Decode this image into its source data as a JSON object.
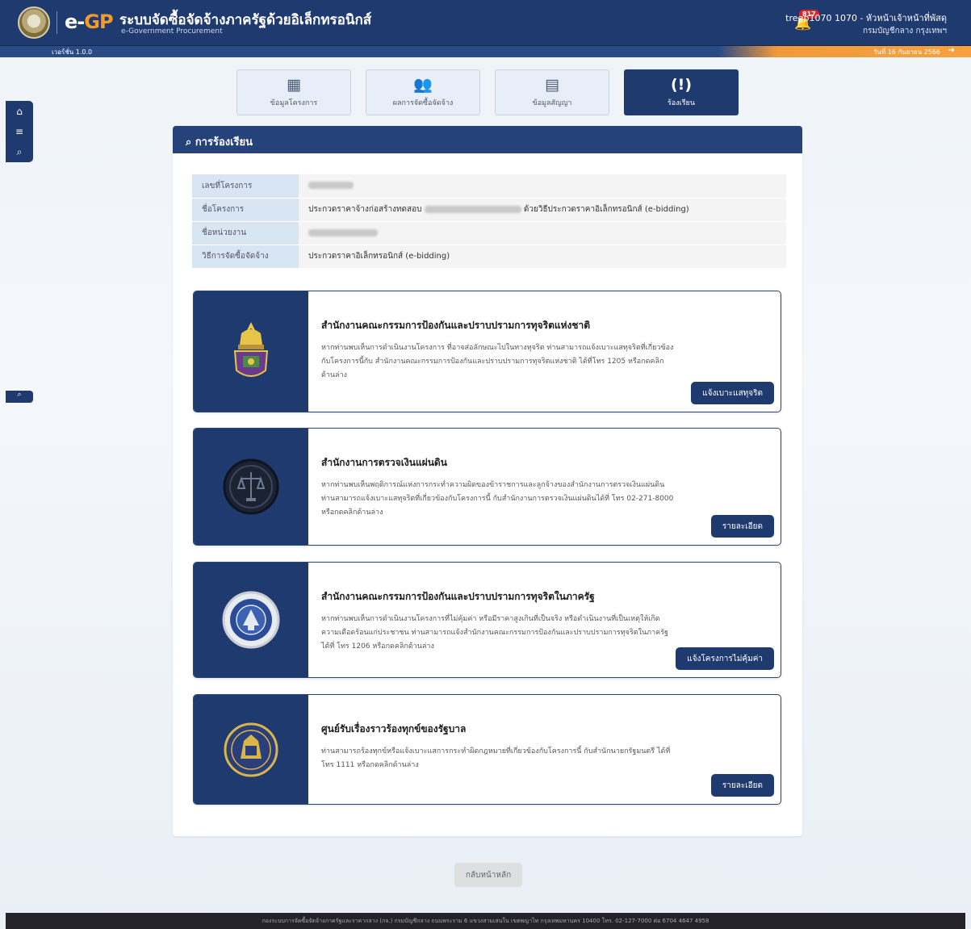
{
  "header": {
    "logo_main": "e-",
    "logo_accent": "GP",
    "app_title": "ระบบจัดซื้อจัดจ้างภาครัฐด้วยอิเล็กทรอนิกส์",
    "app_subtitle": "e-Government Procurement",
    "notification_count": "817",
    "user_name": "tregp1070 1070 - หัวหน้าเจ้าหน้าที่พัสดุ",
    "user_dept": "กรมบัญชีกลาง กรุงเทพฯ",
    "version": "เวอร์ชั่น 1.0.0",
    "date": "วันที่ 16 กันยายน 2566"
  },
  "tabs": [
    {
      "label": "ข้อมูลโครงการ",
      "icon": "building-icon",
      "glyph": "▦"
    },
    {
      "label": "ผลการจัดซื้อจัดจ้าง",
      "icon": "users-icon",
      "glyph": "👥"
    },
    {
      "label": "ข้อมูลสัญญา",
      "icon": "document-icon",
      "glyph": "▤"
    },
    {
      "label": "ร้องเรียน",
      "icon": "complaint-icon",
      "glyph": "(!)"
    }
  ],
  "panel": {
    "title": "การร้องเรียน"
  },
  "info": {
    "rows": [
      {
        "label": "เลขที่โครงการ",
        "value": ""
      },
      {
        "label": "ชื่อโครงการ",
        "value_prefix": "ประกวดราคาจ้างก่อสร้างทดสอบ",
        "value_suffix": "ด้วยวิธีประกวดราคาอิเล็กทรอนิกส์ (e-bidding)"
      },
      {
        "label": "ชื่อหน่วยงาน",
        "value": ""
      },
      {
        "label": "วิธีการจัดซื้อจัดจ้าง",
        "value": "ประกวดราคาอิเล็กทรอนิกส์ (e-bidding)"
      }
    ]
  },
  "cards": [
    {
      "title": "สำนักงานคณะกรรมการป้องกันและปราบปรามการทุจริตแห่งชาติ",
      "desc": "หากท่านพบเห็นการดำเนินงานโครงการ ที่อาจส่อลักษณะไปในทางทุจริต ท่านสามารถแจ้งเบาะแสทุจริตที่เกี่ยวข้องกับโครงการนี้กับ สำนักงานคณะกรรมการป้องกันและปราบปรามการทุจริตแห่งชาติ ได้ที่โทร 1205 หรือกดคลิกด้านล่าง",
      "button": "แจ้งเบาะแสทุจริต",
      "emblem": "nacc-emblem"
    },
    {
      "title": "สำนักงานการตรวจเงินแผ่นดิน",
      "desc": "หากท่านพบเห็นพฤติการณ์แห่งการกระทำความผิดของข้าราชการและลูกจ้างของสำนักงานการตรวจเงินแผ่นดิน ท่านสามารถแจ้งเบาะแสทุจริตที่เกี่ยวข้องกับโครงการนี้ กับสำนักงานการตรวจเงินแผ่นดินได้ที่ โทร 02-271-8000 หรือกดคลิกด้านล่าง",
      "button": "รายละเอียด",
      "emblem": "oag-emblem"
    },
    {
      "title": "สำนักงานคณะกรรมการป้องกันและปราบปรามการทุจริตในภาครัฐ",
      "desc": "หากท่านพบเห็นการดำเนินงานโครงการที่ไม่คุ้มค่า หรือมีราคาสูงเกินที่เป็นจริง หรือดำเนินงานที่เป็นเหตุให้เกิดความเดือดร้อนแก่ประชาชน ท่านสามารถแจ้งสำนักงานคณะกรรมการป้องกันและปราบปรามการทุจริตในภาครัฐ ได้ที่ โทร 1206 หรือกดคลิกด้านล่าง",
      "button": "แจ้งโครงการไม่คุ้มค่า",
      "emblem": "pacc-emblem"
    },
    {
      "title": "ศูนย์รับเรื่องราวร้องทุกข์ของรัฐบาล",
      "desc": "ท่านสามารถร้องทุกข์หรือแจ้งเบาะแสการกระทำผิดกฎหมายที่เกี่ยวข้องกับโครงการนี้ กับสำนักนายกรัฐมนตรี ได้ที่ โทร 1111 หรือกดคลิกด้านล่าง",
      "button": "รายละเอียด",
      "emblem": "opm-emblem"
    }
  ],
  "back_button": "กลับหน้าหลัก",
  "footer": "กองระบบการจัดซื้อจัดจ้างภาครัฐและราคากลาง (กจ.) กรมบัญชีกลาง ถนนพระราม 6 แขวงสามเสนใน เขตพญาไท กรุงเทพมหานคร 10400 โทร. 02-127-7000 ต่อ 6704 4647 4958",
  "colors": {
    "primary": "#1f3a6e",
    "accent": "#f39b2a"
  }
}
